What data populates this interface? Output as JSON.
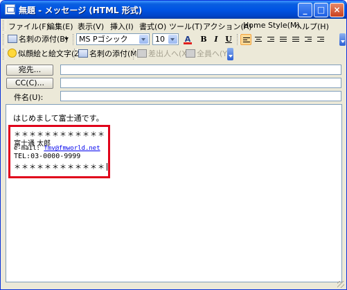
{
  "window": {
    "title": "無題 - メッセージ (HTML 形式)"
  },
  "menu": [
    "ファイル(F)",
    "編集(E)",
    "表示(V)",
    "挿入(I)",
    "書式(O)",
    "ツール(T)",
    "アクション(A)",
    "Home Style(M)",
    "ヘルプ(H)"
  ],
  "toolbar1": {
    "business_card_label": "名刺の添付(B)",
    "font_name": "MS Pゴシック",
    "font_size": "10",
    "bold": "B",
    "italic": "I",
    "underline": "U"
  },
  "toolbar2": {
    "emoticon_label": "似顔絵と絵文字(Z)",
    "business_card_label": "名刺の添付(M)",
    "sender_label": "差出人へ(X)",
    "all_label": "全員へ(Y)"
  },
  "address": {
    "to_button": "宛先...",
    "cc_button": "CC(C)...",
    "subject_label": "件名(U):",
    "to_value": "",
    "cc_value": "",
    "subject_value": ""
  },
  "body": {
    "greeting": "はじめまして富士通です。",
    "sig_line1": "＊＊＊＊＊＊＊＊＊＊＊＊",
    "name": "富士通 太郎",
    "email_prefix": "e-mail:",
    "email": "fmv@fmworld.net",
    "tel": "TEL:03-0000-9999",
    "sig_line2": "＊＊＊＊＊＊＊＊＊＊＊＊"
  },
  "colors": {
    "highlight": "#e0001a",
    "titlebar": "#0054e3",
    "link": "#0000ee"
  }
}
